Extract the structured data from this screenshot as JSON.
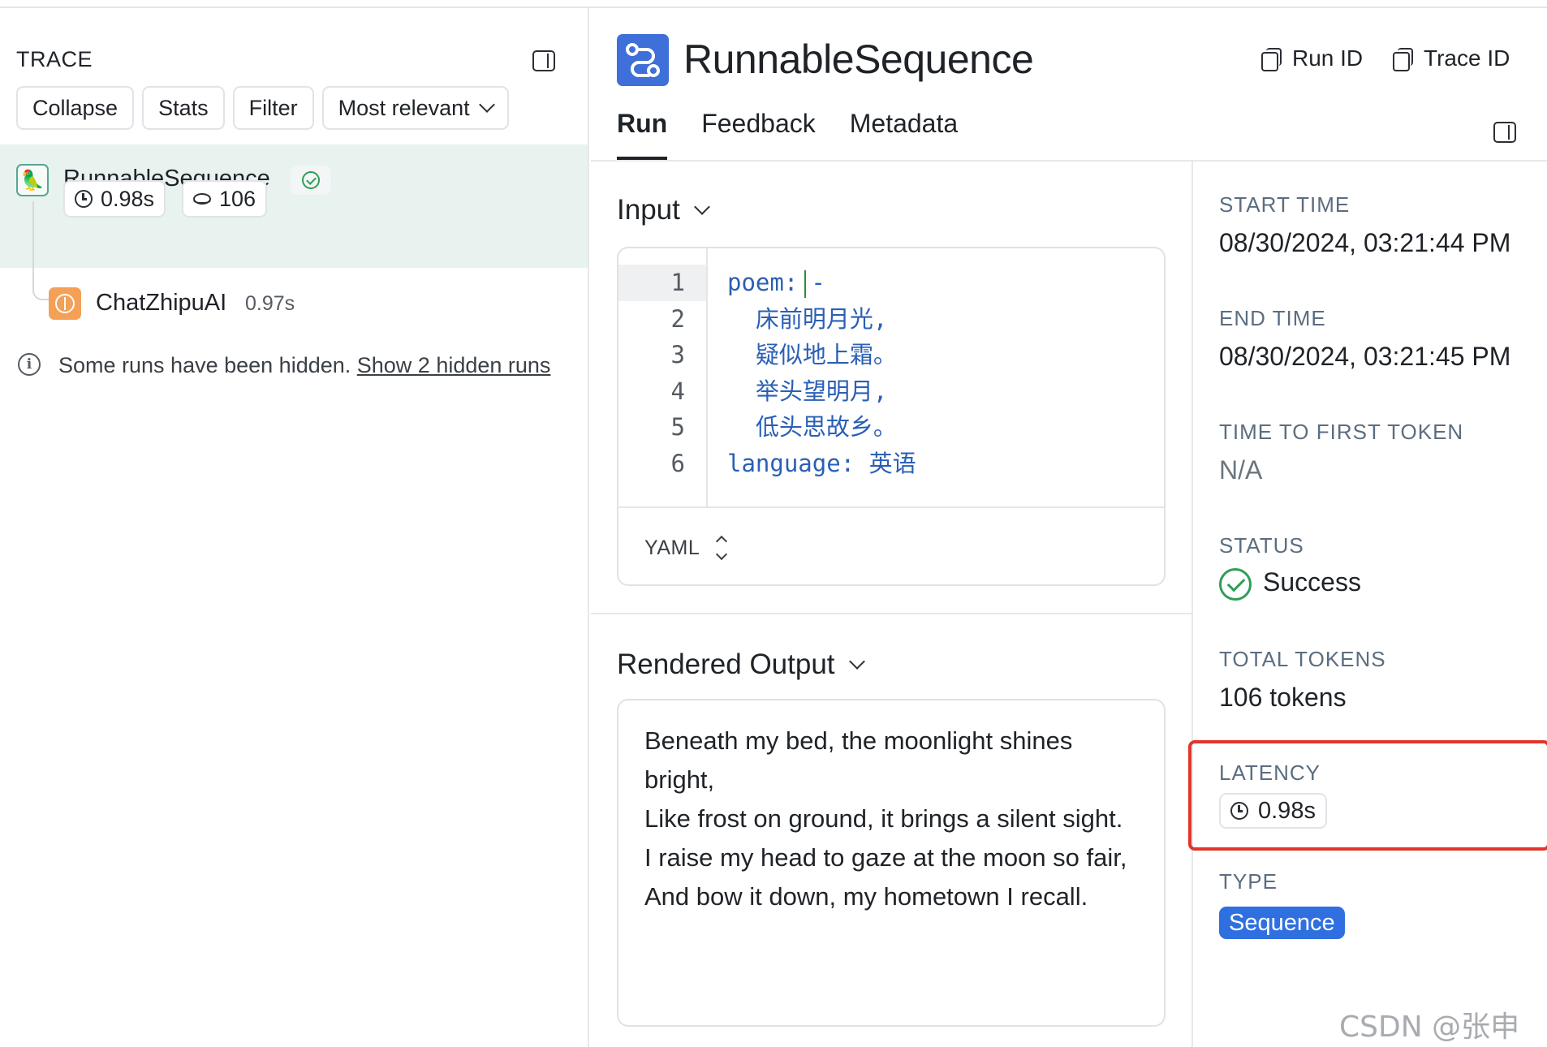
{
  "trace_panel": {
    "title": "TRACE",
    "toolbar": {
      "collapse": "Collapse",
      "stats": "Stats",
      "filter": "Filter",
      "sort": "Most relevant"
    },
    "root_run": {
      "name": "RunnableSequence",
      "latency": "0.98s",
      "tokens": "106",
      "status": "success"
    },
    "child_run": {
      "name": "ChatZhipuAI",
      "latency": "0.97s"
    },
    "hidden_note": {
      "text": "Some runs have been hidden. ",
      "link": "Show 2 hidden runs"
    }
  },
  "header": {
    "title": "RunnableSequence",
    "run_id": "Run ID",
    "trace_id": "Trace ID",
    "tabs": [
      {
        "label": "Run",
        "active": true
      },
      {
        "label": "Feedback",
        "active": false
      },
      {
        "label": "Metadata",
        "active": false
      }
    ]
  },
  "input": {
    "title": "Input",
    "line_numbers": [
      "1",
      "2",
      "3",
      "4",
      "5",
      "6"
    ],
    "lines": [
      "poem:",
      "  床前明月光,",
      "  疑似地上霜。",
      "  举头望明月,",
      "  低头思故乡。",
      "language: 英语"
    ],
    "line1_suffix": "-",
    "format": "YAML"
  },
  "output": {
    "title": "Rendered Output",
    "lines": [
      "Beneath my bed, the moonlight shines bright,",
      "Like frost on ground, it brings a silent sight.",
      "I raise my head to gaze at the moon so fair,",
      "And bow it down, my hometown I recall."
    ]
  },
  "metadata": {
    "start_time_label": "START TIME",
    "start_time": "08/30/2024, 03:21:44 PM",
    "end_time_label": "END TIME",
    "end_time": "08/30/2024, 03:21:45 PM",
    "ttft_label": "TIME TO FIRST TOKEN",
    "ttft": "N/A",
    "status_label": "STATUS",
    "status": "Success",
    "tokens_label": "TOTAL TOKENS",
    "tokens": "106 tokens",
    "latency_label": "LATENCY",
    "latency": "0.98s",
    "type_label": "TYPE",
    "type": "Sequence"
  },
  "watermark": "CSDN @张申傲",
  "colors": {
    "accent_blue": "#3f6fd8",
    "success_green": "#2f9e56",
    "highlight_red": "#e0362d",
    "selected_row": "#e8f2ef",
    "chat_icon": "#f4a056"
  }
}
